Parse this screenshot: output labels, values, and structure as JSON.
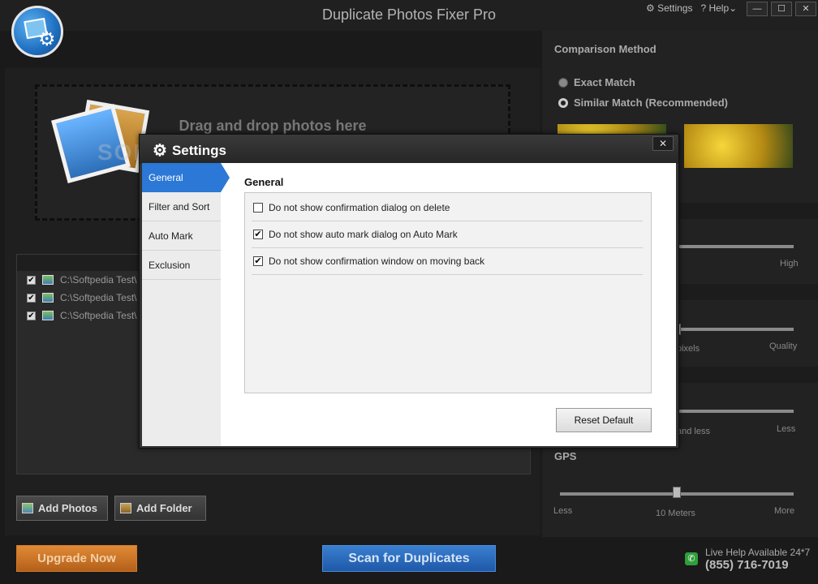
{
  "app": {
    "title": "Duplicate Photos Fixer Pro",
    "top_links": {
      "settings": "Settings",
      "help": "Help"
    },
    "window_buttons": {
      "minimize": "—",
      "maximize": "☐",
      "close": "✕"
    }
  },
  "main": {
    "drop_text": "Drag and drop photos here",
    "watermark": "SOFTPEDIA",
    "files": [
      {
        "path": "C:\\Softpedia Test\\",
        "checked": true
      },
      {
        "path": "C:\\Softpedia Test\\",
        "checked": true
      },
      {
        "path": "C:\\Softpedia Test\\",
        "checked": true
      }
    ],
    "add_photos_label": "Add Photos",
    "add_folder_label": "Add Folder"
  },
  "right_panel": {
    "comparison_title": "Comparison Method",
    "exact_match_label": "Exact Match",
    "similar_match_label": "Similar Match (Recommended)",
    "selected_method": "similar",
    "labels": {
      "high": "High",
      "pixels": "pixels",
      "quality": "Quality",
      "and_less": "and less",
      "less_right": "Less",
      "gps_title": "GPS",
      "gps_less": "Less",
      "gps_value": "10 Meters",
      "gps_more": "More"
    }
  },
  "bottom": {
    "upgrade_label": "Upgrade Now",
    "scan_label": "Scan for Duplicates",
    "live_help": "Live Help Available 24*7",
    "phone": "(855) 716-7019"
  },
  "dialog": {
    "title": "Settings",
    "close_label": "✕",
    "nav": [
      {
        "label": "General",
        "active": true
      },
      {
        "label": "Filter and Sort",
        "active": false
      },
      {
        "label": "Auto Mark",
        "active": false
      },
      {
        "label": "Exclusion",
        "active": false
      }
    ],
    "heading": "General",
    "options": [
      {
        "label": "Do not show confirmation dialog on delete",
        "checked": false
      },
      {
        "label": "Do not show auto mark dialog on Auto Mark",
        "checked": true
      },
      {
        "label": "Do not show confirmation window on moving back",
        "checked": true
      }
    ],
    "reset_label": "Reset Default"
  }
}
